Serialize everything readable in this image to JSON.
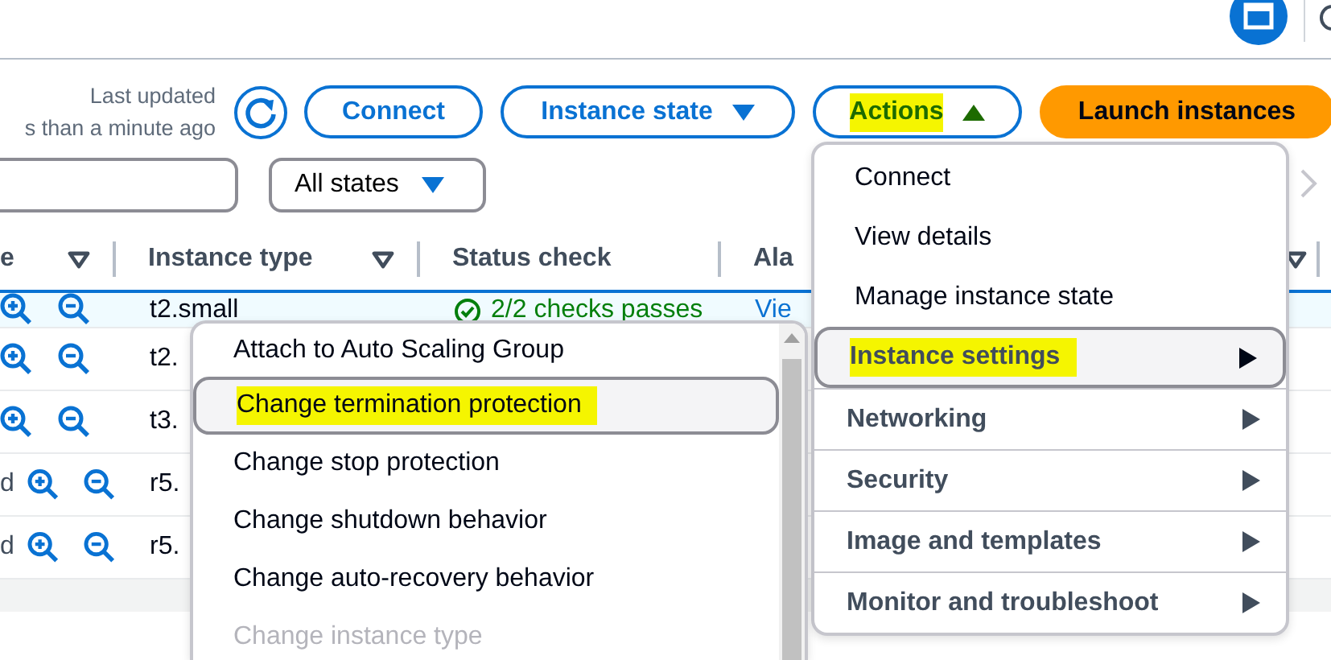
{
  "toolbar": {
    "last_updated": [
      "Last updated",
      "s than a minute ago"
    ],
    "buttons": [
      {
        "label": "Connect",
        "kind": "outline",
        "highlighted": false
      },
      {
        "label": "Instance state",
        "kind": "dropdown",
        "expanded": false,
        "highlighted": false
      },
      {
        "label": "Actions",
        "kind": "dropdown",
        "expanded": true,
        "highlighted": true
      },
      {
        "label": "Launch instances",
        "kind": "primary",
        "highlighted": false
      }
    ]
  },
  "filters": {
    "state_filter": "All states"
  },
  "table": {
    "columns": [
      {
        "label": "e",
        "filter": true
      },
      {
        "label": "Instance type",
        "filter": true
      },
      {
        "label": "Status check",
        "filter": false
      },
      {
        "label": "Ala",
        "filter": true
      }
    ],
    "rows": [
      {
        "selected": true,
        "column_1": "",
        "instance_type": "t2.small",
        "status_check": "2/2 checks passes",
        "alarm": "Vie"
      },
      {
        "selected": false,
        "column_1": "",
        "instance_type": "t2.",
        "status_check": "",
        "alarm": ""
      },
      {
        "selected": false,
        "column_1": "",
        "instance_type": "t3.",
        "status_check": "",
        "alarm": ""
      },
      {
        "selected": false,
        "column_1": "d",
        "instance_type": "r5.",
        "status_check": "",
        "alarm": ""
      },
      {
        "selected": false,
        "column_1": "d",
        "instance_type": "r5.",
        "status_check": "",
        "alarm": ""
      }
    ]
  },
  "actions_menu": {
    "items": [
      {
        "label": "Connect",
        "kind": "action",
        "selected": false,
        "highlighted": false
      },
      {
        "label": "View details",
        "kind": "action",
        "selected": false,
        "highlighted": false
      },
      {
        "label": "Manage instance state",
        "kind": "action",
        "selected": false,
        "highlighted": false
      },
      {
        "label": "Instance settings",
        "kind": "group",
        "selected": true,
        "highlighted": true
      },
      {
        "label": "Networking",
        "kind": "group",
        "selected": false,
        "highlighted": false
      },
      {
        "label": "Security",
        "kind": "group",
        "selected": false,
        "highlighted": false
      },
      {
        "label": "Image and templates",
        "kind": "group",
        "selected": false,
        "highlighted": false
      },
      {
        "label": "Monitor and troubleshoot",
        "kind": "group",
        "selected": false,
        "highlighted": false
      }
    ]
  },
  "submenu": {
    "items": [
      {
        "label": "Attach to Auto Scaling Group",
        "selected": false,
        "highlighted": false,
        "disabled": false
      },
      {
        "label": "Change termination protection",
        "selected": true,
        "highlighted": true,
        "disabled": false
      },
      {
        "label": "Change stop protection",
        "selected": false,
        "highlighted": false,
        "disabled": false
      },
      {
        "label": "Change shutdown behavior",
        "selected": false,
        "highlighted": false,
        "disabled": false
      },
      {
        "label": "Change auto-recovery behavior",
        "selected": false,
        "highlighted": false,
        "disabled": false
      },
      {
        "label": "Change instance type",
        "selected": false,
        "highlighted": false,
        "disabled": true
      }
    ]
  }
}
